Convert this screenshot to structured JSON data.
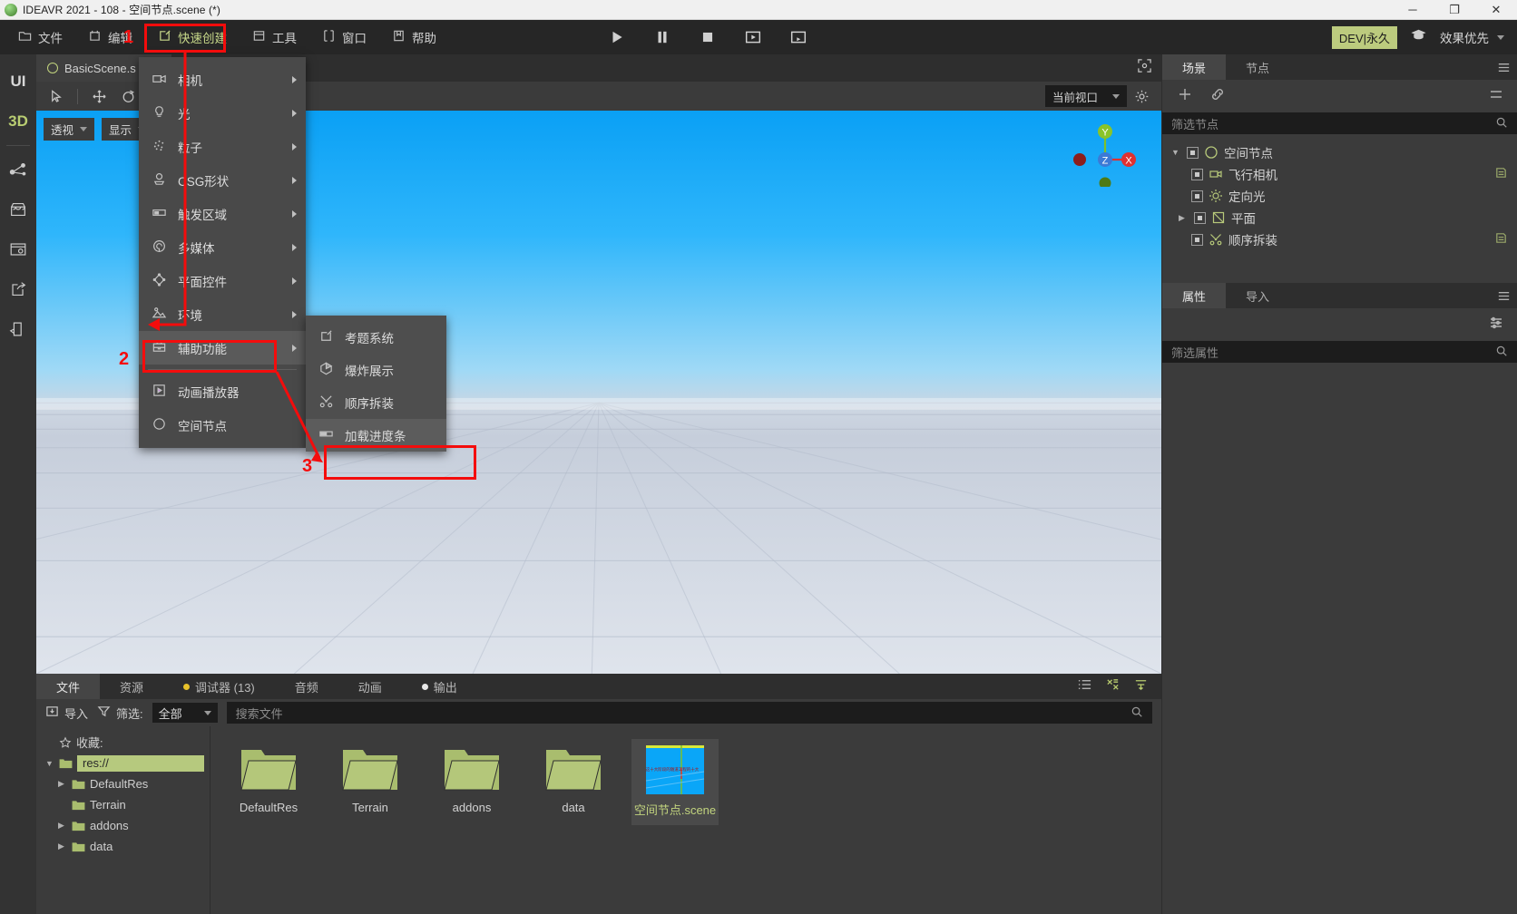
{
  "window": {
    "title": "IDEAVR 2021 - 108 - 空间节点.scene (*)",
    "minimize": "─",
    "maximize": "❐",
    "close": "✕"
  },
  "menubar": {
    "items": [
      {
        "label": "文件",
        "icon": "folder-icon"
      },
      {
        "label": "编辑",
        "icon": "edit-icon"
      },
      {
        "label": "快速创建",
        "icon": "quick-create-icon"
      },
      {
        "label": "工具",
        "icon": "tools-icon"
      },
      {
        "label": "窗口",
        "icon": "window-icon"
      },
      {
        "label": "帮助",
        "icon": "help-icon"
      }
    ],
    "play_controls": [
      "play-icon",
      "pause-icon",
      "stop-icon",
      "play-scene-icon",
      "play-custom-scene-icon"
    ],
    "dev_badge": "DEV|永久",
    "cap_icon": "graduation-cap-icon",
    "effect_select": "效果优先"
  },
  "quick_create_menu": {
    "items": [
      {
        "label": "相机",
        "icon": "camera-icon",
        "has_submenu": true
      },
      {
        "label": "光",
        "icon": "light-icon",
        "has_submenu": true
      },
      {
        "label": "粒子",
        "icon": "particle-icon",
        "has_submenu": true
      },
      {
        "label": "CSG形状",
        "icon": "csg-shape-icon",
        "has_submenu": true
      },
      {
        "label": "触发区域",
        "icon": "trigger-area-icon",
        "has_submenu": true
      },
      {
        "label": "多媒体",
        "icon": "multimedia-icon",
        "has_submenu": true
      },
      {
        "label": "平面控件",
        "icon": "plane-widget-icon",
        "has_submenu": true
      },
      {
        "label": "环境",
        "icon": "environment-icon",
        "has_submenu": true
      },
      {
        "label": "辅助功能",
        "icon": "assist-function-icon",
        "has_submenu": true,
        "selected": true
      }
    ],
    "items_after_sep": [
      {
        "label": "动画播放器",
        "icon": "animation-player-icon"
      },
      {
        "label": "空间节点",
        "icon": "spatial-node-icon"
      }
    ]
  },
  "assist_submenu": {
    "items": [
      {
        "label": "考题系统",
        "icon": "exam-system-icon"
      },
      {
        "label": "爆炸展示",
        "icon": "explode-view-icon"
      },
      {
        "label": "顺序拆装",
        "icon": "sequence-assembly-icon"
      },
      {
        "label": "加载进度条",
        "icon": "loading-progress-bar-icon",
        "highlighted": true
      }
    ]
  },
  "annotations": [
    {
      "number": "1"
    },
    {
      "number": "2"
    },
    {
      "number": "3"
    }
  ],
  "left_rail": {
    "items": [
      {
        "label": "UI",
        "type": "text"
      },
      {
        "label": "3D",
        "type": "text",
        "active": true
      },
      {
        "label": "",
        "icon": "node-graph-icon"
      },
      {
        "label": "",
        "icon": "store-icon"
      },
      {
        "label": "",
        "icon": "browser-settings-icon"
      },
      {
        "label": "",
        "icon": "share-export-icon"
      },
      {
        "label": "",
        "icon": "import-door-icon"
      }
    ]
  },
  "scene_tabs": {
    "tabs": [
      {
        "label": "BasicScene.s",
        "icon": "scene-circle-icon",
        "close": "✕"
      }
    ],
    "add": "+",
    "right_icon": "fullscreen-icon"
  },
  "viewport_toolbar": {
    "tools": [
      "select-icon",
      "move-icon",
      "rotate-icon",
      "scale-icon",
      "transform-icon"
    ],
    "view_select": "当前视口",
    "settings_icon": "gear-icon",
    "perspective_label": "透视",
    "display_label": "显示"
  },
  "gizmo": {
    "x": "X",
    "y": "Y",
    "z": "Z"
  },
  "dock": {
    "tabs": [
      {
        "label": "文件",
        "active": true
      },
      {
        "label": "资源",
        "active": false
      },
      {
        "label": "调试器 (13)",
        "active": false,
        "dot": "#e8c22a"
      },
      {
        "label": "音频",
        "active": false
      },
      {
        "label": "动画",
        "active": false
      },
      {
        "label": "输出",
        "active": false,
        "dot": "#e8e8e8"
      }
    ],
    "right_icons": [
      "list-view-icon",
      "grid-view-icon",
      "sort-icon"
    ],
    "toolbar": {
      "import_label": "导入",
      "filter_label": "筛选:",
      "filter_value": "全部",
      "search_placeholder": "搜索文件"
    },
    "tree": {
      "favorites_label": "收藏:",
      "items": [
        {
          "label": "res://",
          "depth": 0,
          "expanded": true,
          "selected": true
        },
        {
          "label": "DefaultRes",
          "depth": 1,
          "expandable": true
        },
        {
          "label": "Terrain",
          "depth": 1,
          "expandable": false
        },
        {
          "label": "addons",
          "depth": 1,
          "expandable": true
        },
        {
          "label": "data",
          "depth": 1,
          "expandable": true
        }
      ]
    },
    "files": [
      {
        "label": "DefaultRes",
        "type": "folder"
      },
      {
        "label": "Terrain",
        "type": "folder"
      },
      {
        "label": "addons",
        "type": "folder"
      },
      {
        "label": "data",
        "type": "folder"
      },
      {
        "label": "空间节点.scene",
        "type": "scene",
        "selected": true
      }
    ]
  },
  "right_panel": {
    "top_tabs": [
      {
        "label": "场景",
        "active": true
      },
      {
        "label": "节点",
        "active": false
      }
    ],
    "top_menu_icon": "hamburger-icon",
    "toolbar_icons": [
      "add-node-icon",
      "link-icon"
    ],
    "node_filter_placeholder": "筛选节点",
    "nodes": [
      {
        "label": "空间节点",
        "depth": 0,
        "icon": "spatial-node-icon",
        "expanded": true,
        "tail": null
      },
      {
        "label": "飞行相机",
        "depth": 1,
        "icon": "camera-icon",
        "tail": "script-icon"
      },
      {
        "label": "定向光",
        "depth": 1,
        "icon": "sun-icon",
        "tail": null
      },
      {
        "label": "平面",
        "depth": 1,
        "icon": "plane-icon",
        "expandable": true,
        "tail": null
      },
      {
        "label": "顺序拆装",
        "depth": 1,
        "icon": "sequence-assembly-icon",
        "tail": "script-icon"
      }
    ],
    "bottom_tabs": [
      {
        "label": "属性",
        "active": true
      },
      {
        "label": "导入",
        "active": false
      }
    ],
    "prop_tool_icon": "sliders-icon",
    "prop_filter_placeholder": "筛选属性"
  },
  "colors": {
    "accent_olive": "#b6c97e",
    "annotation_red": "#f40c0c",
    "panel_bg": "#3b3b3b",
    "menu_bg": "#494949"
  }
}
